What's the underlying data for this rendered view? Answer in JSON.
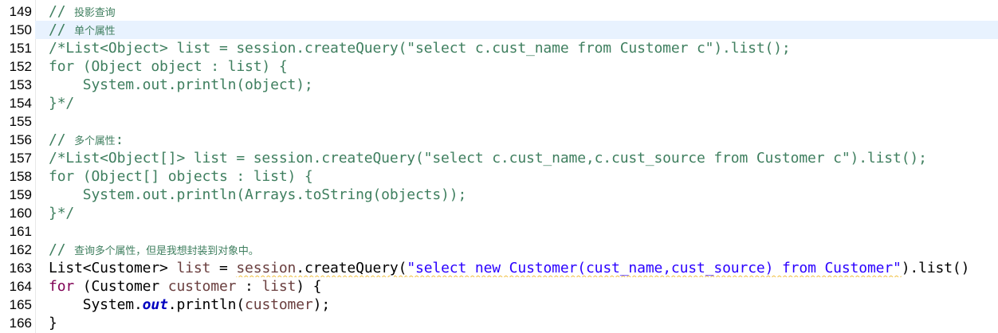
{
  "editor": {
    "current_line": "150",
    "lines": [
      {
        "no": "149",
        "segments": [
          {
            "t": "// ",
            "c": "c-comment"
          },
          {
            "t": "投影查询",
            "c": "c-comment cjk"
          }
        ]
      },
      {
        "no": "150",
        "segments": [
          {
            "t": "// ",
            "c": "c-comment"
          },
          {
            "t": "单个属性",
            "c": "c-comment cjk"
          }
        ]
      },
      {
        "no": "151",
        "segments": [
          {
            "t": "/*List<Object> list = session.createQuery(\"select c.cust_name from Customer c\").list();",
            "c": "c-comment"
          }
        ]
      },
      {
        "no": "152",
        "segments": [
          {
            "t": "for (Object object : list) {",
            "c": "c-comment"
          }
        ]
      },
      {
        "no": "153",
        "segments": [
          {
            "t": "    System.out.println(object);",
            "c": "c-comment"
          }
        ]
      },
      {
        "no": "154",
        "segments": [
          {
            "t": "}*/",
            "c": "c-comment"
          }
        ]
      },
      {
        "no": "155",
        "segments": []
      },
      {
        "no": "156",
        "segments": [
          {
            "t": "// ",
            "c": "c-comment"
          },
          {
            "t": "多个属性",
            "c": "c-comment cjk"
          },
          {
            "t": ":",
            "c": "c-comment"
          }
        ]
      },
      {
        "no": "157",
        "segments": [
          {
            "t": "/*List<Object[]> list = session.createQuery(\"select c.cust_name,c.cust_source from Customer c\").list();",
            "c": "c-comment"
          }
        ]
      },
      {
        "no": "158",
        "segments": [
          {
            "t": "for (Object[] objects : list) {",
            "c": "c-comment"
          }
        ]
      },
      {
        "no": "159",
        "segments": [
          {
            "t": "    System.out.println(Arrays.toString(objects));",
            "c": "c-comment"
          }
        ]
      },
      {
        "no": "160",
        "segments": [
          {
            "t": "}*/",
            "c": "c-comment"
          }
        ]
      },
      {
        "no": "161",
        "segments": []
      },
      {
        "no": "162",
        "segments": [
          {
            "t": "// ",
            "c": "c-comment"
          },
          {
            "t": "查询多个属性，但是我想封装到对象中。",
            "c": "c-comment cjk"
          }
        ]
      },
      {
        "no": "163",
        "segments": [
          {
            "t": "List<Customer> ",
            "c": ""
          },
          {
            "t": "list",
            "c": "c-var"
          },
          {
            "t": " = ",
            "c": ""
          },
          {
            "t": "session",
            "c": "c-var warn"
          },
          {
            "t": ".createQuery(",
            "c": "warn"
          },
          {
            "t": "\"select new Customer(cust_name,cust_source) from Customer\"",
            "c": "c-str warn"
          },
          {
            "t": ").list()",
            "c": ""
          }
        ]
      },
      {
        "no": "164",
        "segments": [
          {
            "t": "for",
            "c": "c-kw"
          },
          {
            "t": " (Customer ",
            "c": ""
          },
          {
            "t": "customer",
            "c": "c-var"
          },
          {
            "t": " : ",
            "c": ""
          },
          {
            "t": "list",
            "c": "c-var"
          },
          {
            "t": ") {",
            "c": ""
          }
        ]
      },
      {
        "no": "165",
        "segments": [
          {
            "t": "    System.",
            "c": ""
          },
          {
            "t": "out",
            "c": "c-field"
          },
          {
            "t": ".println(",
            "c": ""
          },
          {
            "t": "customer",
            "c": "c-var"
          },
          {
            "t": ");",
            "c": ""
          }
        ]
      },
      {
        "no": "166",
        "segments": [
          {
            "t": "}",
            "c": ""
          }
        ]
      }
    ]
  }
}
